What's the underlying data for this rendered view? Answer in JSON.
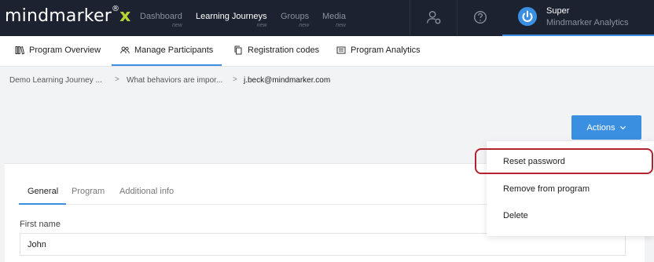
{
  "app": {
    "logo_text": "mindmarker",
    "logo_reg": "®",
    "logo_x": "x",
    "accent_color": "#3b8fe0",
    "highlight_color": "#b3222e"
  },
  "topnav": {
    "items": [
      {
        "label": "Dashboard",
        "badge": "new"
      },
      {
        "label": "Learning Journeys",
        "badge": "new"
      },
      {
        "label": "Groups",
        "badge": "new"
      },
      {
        "label": "Media",
        "badge": "new"
      }
    ],
    "icons": [
      "user-settings-icon",
      "help-icon"
    ],
    "user": {
      "name": "Super",
      "org": "Mindmarker Analytics",
      "icon": "power-icon"
    }
  },
  "subnav": {
    "tabs": [
      {
        "label": "Program Overview",
        "icon": "library-icon"
      },
      {
        "label": "Manage Participants",
        "icon": "users-icon"
      },
      {
        "label": "Registration codes",
        "icon": "copy-icon"
      },
      {
        "label": "Program Analytics",
        "icon": "report-icon"
      }
    ]
  },
  "breadcrumb": {
    "items": [
      "Demo Learning Journey ...",
      "What behaviors are impor...",
      "j.beck@mindmarker.com"
    ],
    "separator": ">"
  },
  "actions": {
    "label": "Actions",
    "menu": [
      "Reset password",
      "Remove from program",
      "Delete"
    ]
  },
  "card": {
    "tabs": [
      "General",
      "Program",
      "Additional info"
    ],
    "field": {
      "label": "First name",
      "value": "John"
    }
  }
}
